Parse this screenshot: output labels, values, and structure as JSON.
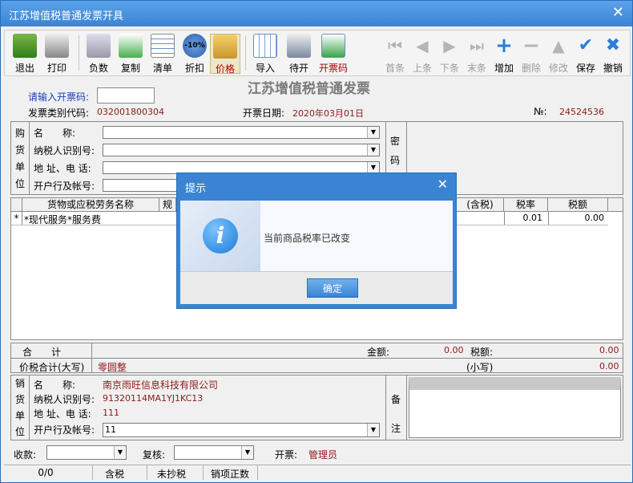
{
  "window": {
    "title": "江苏增值税普通发票开具"
  },
  "toolbar": {
    "left": [
      {
        "label": "退出"
      },
      {
        "label": "打印"
      },
      {
        "label": "负数"
      },
      {
        "label": "复制"
      },
      {
        "label": "清单"
      },
      {
        "label": "折扣"
      },
      {
        "label": "价格"
      },
      {
        "label": "导入"
      },
      {
        "label": "待开"
      },
      {
        "label": "开票码"
      }
    ],
    "discount_badge": "-10%",
    "right": [
      {
        "label": "首条"
      },
      {
        "label": "上条"
      },
      {
        "label": "下条"
      },
      {
        "label": "末条"
      },
      {
        "label": "增加"
      },
      {
        "label": "删除"
      },
      {
        "label": "修改"
      },
      {
        "label": "保存"
      },
      {
        "label": "撤销"
      }
    ]
  },
  "header": {
    "invoice_title": "江苏增值税普通发票",
    "code_prompt": "请输入开票码:",
    "category_label": "发票类别代码:",
    "category_value": "032001800304",
    "date_label": "开票日期:",
    "date_value": "2020年03月01日",
    "no_label": "№:",
    "no_value": "24524536"
  },
  "buyer": {
    "side_label": [
      "购",
      "货",
      "单",
      "位"
    ],
    "name_label": "名　　称:",
    "taxid_label": "纳税人识别号:",
    "addr_label": "地 址、电 话:",
    "bank_label": "开户行及帐号:",
    "secret_label": [
      "密",
      "码"
    ]
  },
  "table": {
    "headers": [
      "货物或应税劳务名称",
      "规",
      "(含税)",
      "税率",
      "税额"
    ],
    "rows": [
      {
        "marker": "*",
        "name": "*现代服务*服务费",
        "rate": "0.01",
        "tax": "0.00"
      }
    ]
  },
  "totals": {
    "sum_label": "合　　计",
    "amount_label": "金额:",
    "amount_value": "0.00",
    "tax_label": "税额:",
    "tax_value": "0.00",
    "total_label": "价税合计(大写)",
    "total_upper": "零圆整",
    "small_label": "(小写)",
    "small_value": "0.00"
  },
  "seller": {
    "side_label": [
      "销",
      "货",
      "单",
      "位"
    ],
    "name_label": "名　　称:",
    "name_value": "南京雨旺信息科技有限公司",
    "taxid_label": "纳税人识别号:",
    "taxid_value": "91320114MA1YJ1KC13",
    "addr_label": "地 址、电 话:",
    "addr_value": "111",
    "bank_label": "开户行及帐号:",
    "bank_value": "11",
    "remark_label": [
      "备",
      "注"
    ]
  },
  "footer": {
    "payee_label": "收款:",
    "review_label": "复核:",
    "issuer_label": "开票:",
    "issuer_value": "管理员"
  },
  "status": [
    "0/0",
    "含税",
    "未抄税",
    "销项正数"
  ],
  "dialog": {
    "title": "提示",
    "message": "当前商品税率已改变",
    "ok": "确定",
    "icon": "info-icon"
  }
}
